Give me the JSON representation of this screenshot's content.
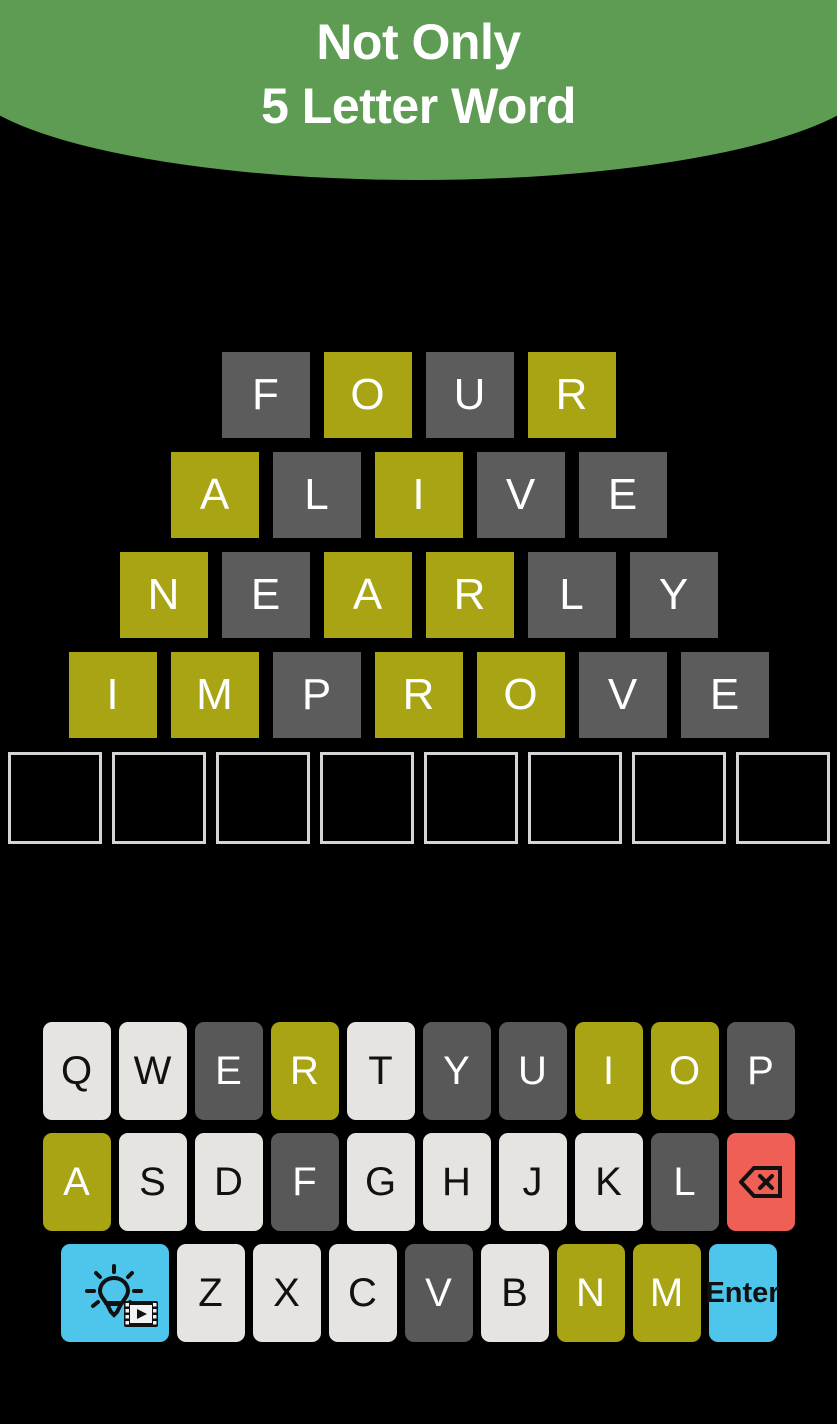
{
  "header": {
    "title_line1": "Not Only",
    "title_line2": "5 Letter Word",
    "background_color": "#5d9c52",
    "text_color": "#ffffff"
  },
  "colors": {
    "page_background": "#000000",
    "tile_absent": "#5c5c5c",
    "tile_present": "#a8a413",
    "tile_empty_border": "#d5d5d5",
    "key_unused": "#e6e4e1",
    "key_absent": "#585858",
    "key_present": "#a8a413",
    "key_delete": "#ef5f55",
    "key_enter": "#4ec5ea",
    "key_hint": "#4ec5ea"
  },
  "board": {
    "rows": [
      {
        "word": "FOUR",
        "length": 4,
        "tiles": [
          {
            "letter": "F",
            "state": "absent"
          },
          {
            "letter": "O",
            "state": "present"
          },
          {
            "letter": "U",
            "state": "absent"
          },
          {
            "letter": "R",
            "state": "present"
          }
        ]
      },
      {
        "word": "ALIVE",
        "length": 5,
        "tiles": [
          {
            "letter": "A",
            "state": "present"
          },
          {
            "letter": "L",
            "state": "absent"
          },
          {
            "letter": "I",
            "state": "present"
          },
          {
            "letter": "V",
            "state": "absent"
          },
          {
            "letter": "E",
            "state": "absent"
          }
        ]
      },
      {
        "word": "NEARLY",
        "length": 6,
        "tiles": [
          {
            "letter": "N",
            "state": "present"
          },
          {
            "letter": "E",
            "state": "absent"
          },
          {
            "letter": "A",
            "state": "present"
          },
          {
            "letter": "R",
            "state": "present"
          },
          {
            "letter": "L",
            "state": "absent"
          },
          {
            "letter": "Y",
            "state": "absent"
          }
        ]
      },
      {
        "word": "IMPROVE",
        "length": 7,
        "tiles": [
          {
            "letter": "I",
            "state": "present"
          },
          {
            "letter": "M",
            "state": "present"
          },
          {
            "letter": "P",
            "state": "absent"
          },
          {
            "letter": "R",
            "state": "present"
          },
          {
            "letter": "O",
            "state": "present"
          },
          {
            "letter": "V",
            "state": "absent"
          },
          {
            "letter": "E",
            "state": "absent"
          }
        ]
      },
      {
        "word": "",
        "length": 8,
        "tiles": [
          {
            "letter": "",
            "state": "empty"
          },
          {
            "letter": "",
            "state": "empty"
          },
          {
            "letter": "",
            "state": "empty"
          },
          {
            "letter": "",
            "state": "empty"
          },
          {
            "letter": "",
            "state": "empty"
          },
          {
            "letter": "",
            "state": "empty"
          },
          {
            "letter": "",
            "state": "empty"
          },
          {
            "letter": "",
            "state": "empty"
          }
        ]
      }
    ]
  },
  "keyboard": {
    "rows": [
      [
        {
          "label": "Q",
          "state": "unused"
        },
        {
          "label": "W",
          "state": "unused"
        },
        {
          "label": "E",
          "state": "absent"
        },
        {
          "label": "R",
          "state": "present"
        },
        {
          "label": "T",
          "state": "unused"
        },
        {
          "label": "Y",
          "state": "absent"
        },
        {
          "label": "U",
          "state": "absent"
        },
        {
          "label": "I",
          "state": "present"
        },
        {
          "label": "O",
          "state": "present"
        },
        {
          "label": "P",
          "state": "absent"
        }
      ],
      [
        {
          "label": "A",
          "state": "present"
        },
        {
          "label": "S",
          "state": "unused"
        },
        {
          "label": "D",
          "state": "unused"
        },
        {
          "label": "F",
          "state": "absent"
        },
        {
          "label": "G",
          "state": "unused"
        },
        {
          "label": "H",
          "state": "unused"
        },
        {
          "label": "J",
          "state": "unused"
        },
        {
          "label": "K",
          "state": "unused"
        },
        {
          "label": "L",
          "state": "absent"
        },
        {
          "label": "",
          "state": "action-del",
          "icon": "backspace-icon"
        }
      ],
      [
        {
          "label": "",
          "state": "action-hint",
          "icon": "lightbulb-video-icon"
        },
        {
          "label": "Z",
          "state": "unused"
        },
        {
          "label": "X",
          "state": "unused"
        },
        {
          "label": "C",
          "state": "unused"
        },
        {
          "label": "V",
          "state": "absent"
        },
        {
          "label": "B",
          "state": "unused"
        },
        {
          "label": "N",
          "state": "present"
        },
        {
          "label": "M",
          "state": "present"
        },
        {
          "label": "Enter",
          "state": "action-enter"
        }
      ]
    ]
  }
}
